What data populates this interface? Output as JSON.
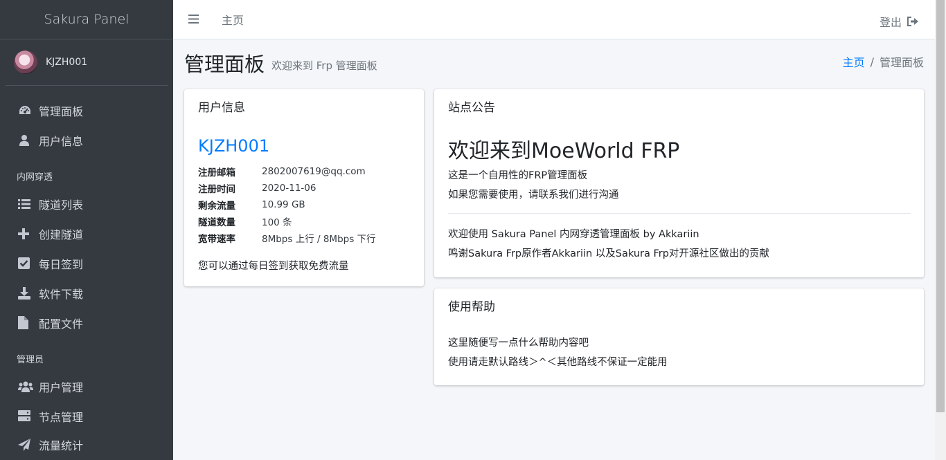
{
  "sidebar": {
    "brand": "Sakura Panel",
    "user": "KJZH001",
    "items_main": [
      {
        "label": "管理面板",
        "icon": "tachometer-icon"
      },
      {
        "label": "用户信息",
        "icon": "user-icon"
      }
    ],
    "section_frp": "内网穿透",
    "items_frp": [
      {
        "label": "隧道列表",
        "icon": "list-icon"
      },
      {
        "label": "创建隧道",
        "icon": "plus-icon"
      },
      {
        "label": "每日签到",
        "icon": "check-square-icon"
      },
      {
        "label": "软件下载",
        "icon": "download-icon"
      },
      {
        "label": "配置文件",
        "icon": "file-icon"
      }
    ],
    "section_admin": "管理员",
    "items_admin": [
      {
        "label": "用户管理",
        "icon": "users-icon"
      },
      {
        "label": "节点管理",
        "icon": "server-icon"
      },
      {
        "label": "流量统计",
        "icon": "paper-plane-icon"
      }
    ]
  },
  "topbar": {
    "home_label": "主页",
    "logout_label": "登出"
  },
  "header": {
    "title": "管理面板",
    "subtitle": "欢迎来到 Frp 管理面板",
    "breadcrumb_home": "主页",
    "breadcrumb_separator": "/",
    "breadcrumb_current": "管理面板"
  },
  "user_card": {
    "title": "用户信息",
    "username": "KJZH001",
    "rows": [
      {
        "label": "注册邮箱",
        "value": "2802007619@qq.com"
      },
      {
        "label": "注册时间",
        "value": "2020-11-06"
      },
      {
        "label": "剩余流量",
        "value": "10.99 GB"
      },
      {
        "label": "隧道数量",
        "value": "100 条"
      },
      {
        "label": "宽带速率",
        "value": "8Mbps 上行 / 8Mbps 下行"
      }
    ],
    "note": "您可以通过每日签到获取免费流量"
  },
  "notice_card": {
    "title": "站点公告",
    "heading": "欢迎来到MoeWorld FRP",
    "line1": "这是一个自用性的FRP管理面板",
    "line2": "如果您需要使用，请联系我们进行沟通",
    "line3": "欢迎使用 Sakura Panel 内网穿透管理面板 by Akkariin",
    "line4": "鸣谢Sakura Frp原作者Akkariin 以及Sakura Frp对开源社区做出的贡献"
  },
  "help_card": {
    "title": "使用帮助",
    "line1": "这里随便写一点什么帮助内容吧",
    "line2": "使用请走默认路线＞^＜其他路线不保证一定能用"
  },
  "colors": {
    "sidebar_bg": "#343a40",
    "link": "#007bff",
    "content_bg": "#f4f6f9"
  }
}
